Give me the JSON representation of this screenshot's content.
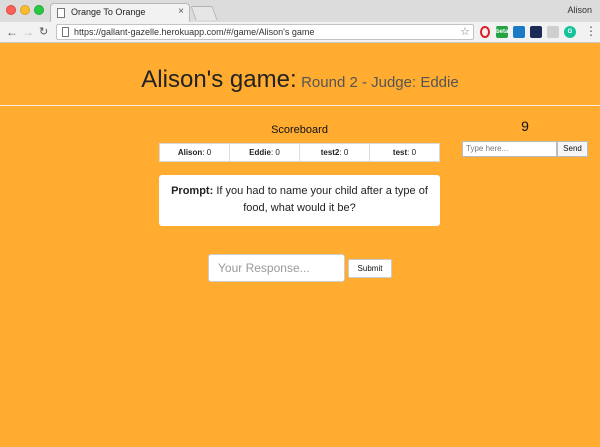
{
  "browser": {
    "tab_title": "Orange To Orange",
    "tab_close": "×",
    "profile_name": "Alison",
    "url": "https://gallant-gazelle.herokuapp.com/#/game/Alison's game",
    "extensions": [
      "opera-icon",
      "beta-icon",
      "cast-icon",
      "chip-icon",
      "puzzle-icon",
      "grammarly-icon"
    ],
    "beta_label": "beta"
  },
  "header": {
    "game_name": "Alison's game:",
    "round_info": "Round 2 - Judge: Eddie"
  },
  "scoreboard": {
    "title": "Scoreboard",
    "players": [
      {
        "name": "Alison",
        "score": "0"
      },
      {
        "name": "Eddie",
        "score": "0"
      },
      {
        "name": "test2",
        "score": "0"
      },
      {
        "name": "test",
        "score": "0"
      }
    ]
  },
  "prompt": {
    "label": "Prompt:",
    "text": "If you had to name your child after a type of food, what would it be?"
  },
  "response": {
    "placeholder": "Your Response...",
    "submit_label": "Submit"
  },
  "chat": {
    "timer": "9",
    "placeholder": "Type here...",
    "send_label": "Send"
  },
  "colors": {
    "page_background": "#ffac30"
  }
}
